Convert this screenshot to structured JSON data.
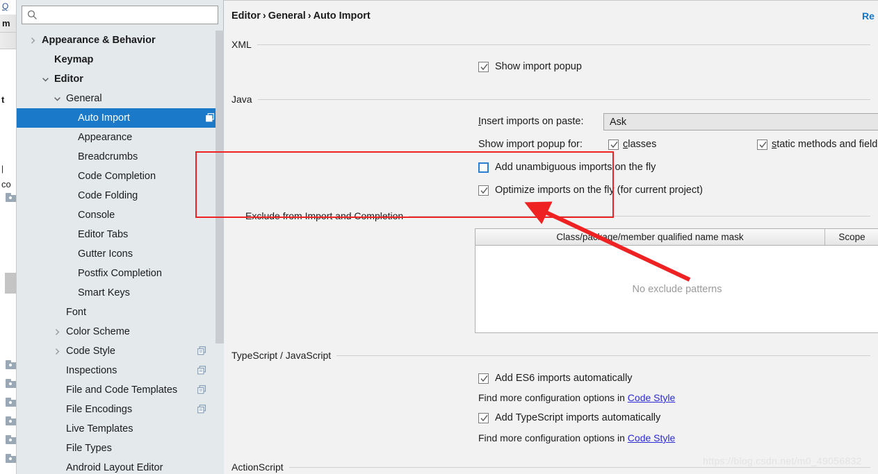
{
  "window": {
    "left_strip": {
      "tab_link_label": "Q",
      "tab_m_label": "m",
      "tab_t_label": "t",
      "tab_i_label": "|",
      "tab_co_label": "co"
    },
    "watermark": "https://blog.csdn.net/m0_49056832"
  },
  "search": {
    "value": "",
    "placeholder": "",
    "icon": "search-icon"
  },
  "tree": {
    "items": [
      {
        "label": "Appearance & Behavior",
        "indent": 36,
        "bold": true,
        "arrow": "chevron-right",
        "selected": false,
        "copy_icon": false
      },
      {
        "label": "Keymap",
        "indent": 54,
        "bold": true,
        "arrow": "",
        "selected": false,
        "copy_icon": false
      },
      {
        "label": "Editor",
        "indent": 54,
        "bold": true,
        "arrow": "chevron-down",
        "selected": false,
        "copy_icon": false
      },
      {
        "label": "General",
        "indent": 71,
        "bold": false,
        "arrow": "chevron-down",
        "selected": false,
        "copy_icon": false
      },
      {
        "label": "Auto Import",
        "indent": 88,
        "bold": false,
        "arrow": "",
        "selected": true,
        "copy_icon": true
      },
      {
        "label": "Appearance",
        "indent": 88,
        "bold": false,
        "arrow": "",
        "selected": false,
        "copy_icon": false
      },
      {
        "label": "Breadcrumbs",
        "indent": 88,
        "bold": false,
        "arrow": "",
        "selected": false,
        "copy_icon": false
      },
      {
        "label": "Code Completion",
        "indent": 88,
        "bold": false,
        "arrow": "",
        "selected": false,
        "copy_icon": false
      },
      {
        "label": "Code Folding",
        "indent": 88,
        "bold": false,
        "arrow": "",
        "selected": false,
        "copy_icon": false
      },
      {
        "label": "Console",
        "indent": 88,
        "bold": false,
        "arrow": "",
        "selected": false,
        "copy_icon": false
      },
      {
        "label": "Editor Tabs",
        "indent": 88,
        "bold": false,
        "arrow": "",
        "selected": false,
        "copy_icon": false
      },
      {
        "label": "Gutter Icons",
        "indent": 88,
        "bold": false,
        "arrow": "",
        "selected": false,
        "copy_icon": false
      },
      {
        "label": "Postfix Completion",
        "indent": 88,
        "bold": false,
        "arrow": "",
        "selected": false,
        "copy_icon": false
      },
      {
        "label": "Smart Keys",
        "indent": 88,
        "bold": false,
        "arrow": "",
        "selected": false,
        "copy_icon": false
      },
      {
        "label": "Font",
        "indent": 71,
        "bold": false,
        "arrow": "",
        "selected": false,
        "copy_icon": false
      },
      {
        "label": "Color Scheme",
        "indent": 71,
        "bold": false,
        "arrow": "chevron-right",
        "selected": false,
        "copy_icon": false
      },
      {
        "label": "Code Style",
        "indent": 71,
        "bold": false,
        "arrow": "chevron-right",
        "selected": false,
        "copy_icon": true
      },
      {
        "label": "Inspections",
        "indent": 71,
        "bold": false,
        "arrow": "",
        "selected": false,
        "copy_icon": true
      },
      {
        "label": "File and Code Templates",
        "indent": 71,
        "bold": false,
        "arrow": "",
        "selected": false,
        "copy_icon": true
      },
      {
        "label": "File Encodings",
        "indent": 71,
        "bold": false,
        "arrow": "",
        "selected": false,
        "copy_icon": true
      },
      {
        "label": "Live Templates",
        "indent": 71,
        "bold": false,
        "arrow": "",
        "selected": false,
        "copy_icon": false
      },
      {
        "label": "File Types",
        "indent": 71,
        "bold": false,
        "arrow": "",
        "selected": false,
        "copy_icon": false
      },
      {
        "label": "Android Layout Editor",
        "indent": 71,
        "bold": false,
        "arrow": "",
        "selected": false,
        "copy_icon": false
      }
    ]
  },
  "main": {
    "breadcrumb": {
      "part1": "Editor",
      "sep1": "›",
      "part2": "General",
      "sep2": "›",
      "part3": "Auto Import"
    },
    "reset_label": "Re",
    "sections": {
      "xml": "XML",
      "java": "Java",
      "exclude": "Exclude from Import and Completion",
      "typescript": "TypeScript / JavaScript",
      "actionscript": "ActionScript"
    },
    "xml": {
      "show_import_popup": {
        "label": "Show import popup",
        "checked": true
      }
    },
    "java": {
      "insert_imports_label": "Insert imports on paste:",
      "insert_imports_value": "Ask",
      "show_popup_for_label": "Show import popup for:",
      "classes": {
        "label": "classes",
        "mnemonic": "c",
        "checked": true
      },
      "static_methods": {
        "label": "static methods and fields",
        "mnemonic": "s",
        "checked": true
      },
      "add_unambiguous": {
        "label": "Add unambiguous imports on the fly",
        "checked": false,
        "focused": true
      },
      "optimize_imports": {
        "label": "Optimize imports on the fly (for current project)",
        "checked": true
      }
    },
    "exclude_table": {
      "col_mask": "Class/package/member qualified name mask",
      "col_scope": "Scope",
      "empty_text": "No exclude patterns",
      "add_button": "+",
      "remove_button": "−"
    },
    "typescript": {
      "es6": {
        "label": "Add ES6 imports automatically",
        "checked": true
      },
      "es6_hint_prefix": "Find more configuration options in ",
      "es6_hint_link": "Code Style",
      "ts": {
        "label": "Add TypeScript imports automatically",
        "checked": true
      },
      "ts_hint_prefix": "Find more configuration options in ",
      "ts_hint_link": "Code Style"
    }
  },
  "annotation": {
    "highlight_color": "#ee2222",
    "arrow_color": "#ee2222"
  }
}
